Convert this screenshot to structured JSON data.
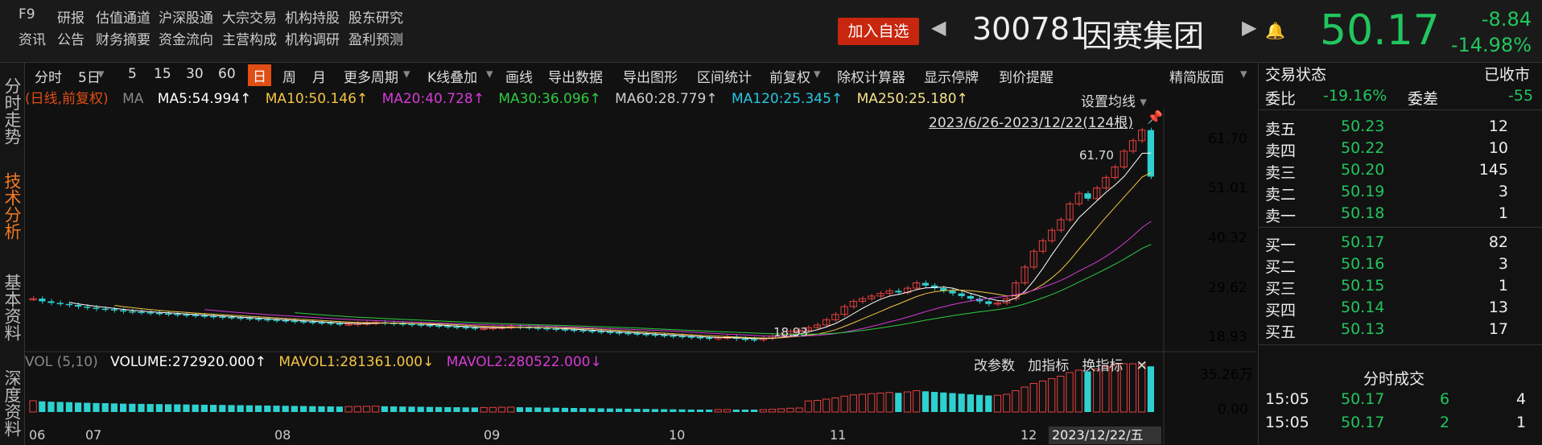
{
  "header": {
    "nav_row1": [
      "F9",
      "研报",
      "估值通道",
      "沪深股通",
      "大宗交易",
      "机构持股",
      "股东研究"
    ],
    "nav_row2": [
      "资讯",
      "公告",
      "财务摘要",
      "资金流向",
      "主营构成",
      "机构调研",
      "盈利预测"
    ],
    "add_watch": "加入自选",
    "code": "300781",
    "name": "因赛集团",
    "price": "50.17",
    "change": "-8.84",
    "change_pct": "-14.98%"
  },
  "left_tabs": [
    {
      "label": "分时走势",
      "active": false
    },
    {
      "label": "技术分析",
      "active": true
    },
    {
      "label": "基本资料",
      "active": false
    },
    {
      "label": "深度资料",
      "active": false
    }
  ],
  "toolbar": {
    "items": [
      "分时",
      "5日",
      "5",
      "15",
      "30",
      "60",
      "日",
      "周",
      "月",
      "更多周期",
      "K线叠加",
      "画线",
      "导出数据",
      "导出图形",
      "区间统计",
      "前复权",
      "除权计算器",
      "显示停牌",
      "到价提醒",
      "精简版面"
    ],
    "active": "日"
  },
  "ma_line": {
    "adj": "(日线,前复权)",
    "ma_label": "MA",
    "items": [
      {
        "text": "MA5:54.994↑",
        "color": "#ffffff"
      },
      {
        "text": "MA10:50.146↑",
        "color": "#f5c542"
      },
      {
        "text": "MA20:40.728↑",
        "color": "#d63bd6"
      },
      {
        "text": "MA30:36.096↑",
        "color": "#2ecc40"
      },
      {
        "text": "MA60:28.779↑",
        "color": "#cccccc"
      },
      {
        "text": "MA120:25.345↑",
        "color": "#29c7e0"
      },
      {
        "text": "MA250:25.180↑",
        "color": "#f7e38a"
      }
    ]
  },
  "chart_labels": {
    "set_ma": "设置均线",
    "range": "2023/6/26-2023/12/22(124根)",
    "high_label": "61.70",
    "low_label": "18.93",
    "y_ticks": [
      "61.70",
      "51.01",
      "40.32",
      "29.62",
      "18.93"
    ],
    "x_ticks": [
      "06",
      "07",
      "08",
      "09",
      "10",
      "11",
      "12"
    ],
    "cursor_date": "2023/12/22/五"
  },
  "volume": {
    "legend_name": "VOL (5,10)",
    "items": [
      {
        "text": "VOLUME:272920.000↑",
        "color": "#ffffff"
      },
      {
        "text": "MAVOL1:281361.000↓",
        "color": "#f5c542"
      },
      {
        "text": "MAVOL2:280522.000↓",
        "color": "#d63bd6"
      }
    ],
    "buttons": [
      "改参数",
      "加指标",
      "换指标"
    ],
    "y_ticks": [
      "35.26万",
      "0.00"
    ]
  },
  "chart_data": {
    "type": "candlestick",
    "y_range": [
      18.93,
      61.7
    ],
    "closes": [
      27,
      26.5,
      26.2,
      26,
      25.8,
      25.5,
      25.3,
      25.1,
      25,
      24.8,
      24.6,
      24.5,
      24.4,
      24.3,
      24.2,
      24.1,
      24,
      23.9,
      23.8,
      23.7,
      23.6,
      23.5,
      23.4,
      23.3,
      23.2,
      23.1,
      23,
      22.9,
      22.8,
      22.7,
      22.6,
      22.5,
      22.4,
      22.3,
      22.2,
      22.2,
      22.3,
      22.4,
      22.5,
      22.4,
      22.3,
      22.2,
      22.1,
      22,
      21.9,
      21.8,
      21.7,
      21.6,
      21.5,
      21.4,
      21.4,
      21.5,
      21.6,
      21.7,
      21.6,
      21.5,
      21.4,
      21.3,
      21.2,
      21.1,
      21,
      20.9,
      20.8,
      20.7,
      20.6,
      20.5,
      20.4,
      20.3,
      20.2,
      20.1,
      20,
      19.9,
      19.8,
      19.7,
      19.6,
      19.5,
      19.6,
      19.7,
      19.4,
      19.3,
      19.2,
      19.5,
      19.9,
      20.3,
      20.8,
      21,
      21.5,
      22,
      23,
      24,
      25.5,
      26.5,
      27,
      27.5,
      28,
      28.5,
      28.2,
      29,
      30,
      29.5,
      29,
      28.5,
      28,
      27.5,
      27,
      26.5,
      26,
      26.2,
      27,
      30,
      33,
      36,
      38,
      40,
      42,
      45,
      47,
      46,
      48,
      50,
      52,
      55,
      57,
      59,
      50.17
    ]
  }
}
